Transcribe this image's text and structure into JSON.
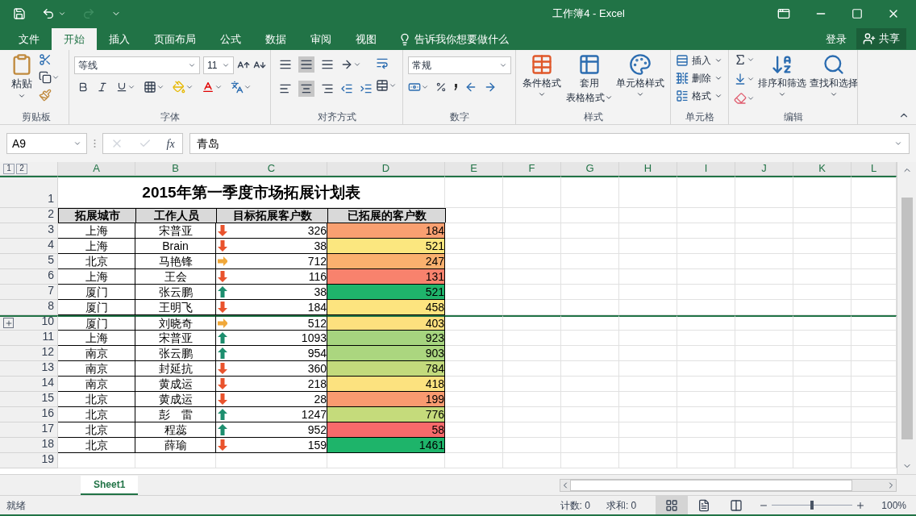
{
  "window": {
    "title": "工作簿4 - Excel"
  },
  "tabs": [
    {
      "label": "文件",
      "selected": false
    },
    {
      "label": "开始",
      "selected": true
    },
    {
      "label": "插入",
      "selected": false
    },
    {
      "label": "页面布局",
      "selected": false
    },
    {
      "label": "公式",
      "selected": false
    },
    {
      "label": "数据",
      "selected": false
    },
    {
      "label": "审阅",
      "selected": false
    },
    {
      "label": "视图",
      "selected": false
    }
  ],
  "tell_me": {
    "placeholder": "告诉我你想要做什么"
  },
  "sign_in": "登录",
  "share": "共享",
  "ribbon": {
    "clipboard": {
      "label": "剪贴板",
      "paste": "粘贴"
    },
    "font": {
      "label": "字体",
      "font": "等线",
      "size": "11"
    },
    "alignment": {
      "label": "对齐方式"
    },
    "number": {
      "label": "数字",
      "format": "常规"
    },
    "styles": {
      "label": "样式",
      "buttons": [
        "条件格式",
        "套用",
        "表格格式",
        "单元格样式"
      ]
    },
    "cells": {
      "label": "单元格",
      "items": [
        "插入",
        "删除",
        "格式"
      ]
    },
    "editing": {
      "label": "编辑",
      "buttons": [
        "排序和筛选",
        "查找和选择"
      ]
    }
  },
  "formula_bar": {
    "name_box": "A9",
    "fx": "fx",
    "value": "青岛"
  },
  "outline_levels": [
    "1",
    "2"
  ],
  "columns": [
    "A",
    "B",
    "C",
    "D",
    "E",
    "F",
    "G",
    "H",
    "I",
    "J",
    "K",
    "L"
  ],
  "sheet_title": {
    "row": "1",
    "text": "2015年第一季度市场拓展计划表"
  },
  "header_row": {
    "row": "2",
    "cells": [
      "拓展城市",
      "工作人员",
      "目标拓展客户数",
      "已拓展的客户数"
    ]
  },
  "rows": [
    {
      "row": "3",
      "city": "上海",
      "name": "宋普亚",
      "trend": {
        "kind": "down"
      },
      "target": "326",
      "done": "184",
      "color": "#f9a071",
      "after_hidden": false
    },
    {
      "row": "4",
      "city": "上海",
      "name": "Brain",
      "trend": {
        "kind": "down"
      },
      "target": "38",
      "done": "521",
      "color": "#fbe77f",
      "after_hidden": false
    },
    {
      "row": "5",
      "city": "北京",
      "name": "马艳锋",
      "trend": {
        "kind": "right"
      },
      "target": "712",
      "done": "247",
      "color": "#fab06e",
      "after_hidden": false
    },
    {
      "row": "6",
      "city": "上海",
      "name": "王会",
      "trend": {
        "kind": "down"
      },
      "target": "116",
      "done": "131",
      "color": "#f8826d",
      "after_hidden": false
    },
    {
      "row": "7",
      "city": "厦门",
      "name": "张云鹏",
      "trend": {
        "kind": "up"
      },
      "target": "38",
      "done": "521",
      "color": "#1fb46b",
      "after_hidden": false
    },
    {
      "row": "8",
      "city": "厦门",
      "name": "王明飞",
      "trend": {
        "kind": "down"
      },
      "target": "184",
      "done": "458",
      "color": "#fde47f",
      "after_hidden": false
    },
    {
      "row": "10",
      "city": "厦门",
      "name": "刘晓奇",
      "trend": {
        "kind": "right"
      },
      "target": "512",
      "done": "403",
      "color": "#fde07e",
      "after_hidden": true
    },
    {
      "row": "11",
      "city": "上海",
      "name": "宋普亚",
      "trend": {
        "kind": "up"
      },
      "target": "1093",
      "done": "923",
      "color": "#a6d47f",
      "after_hidden": false
    },
    {
      "row": "12",
      "city": "南京",
      "name": "张云鹏",
      "trend": {
        "kind": "up"
      },
      "target": "954",
      "done": "903",
      "color": "#abd67f",
      "after_hidden": false
    },
    {
      "row": "13",
      "city": "南京",
      "name": "封延抗",
      "trend": {
        "kind": "down"
      },
      "target": "360",
      "done": "784",
      "color": "#c3da7c",
      "after_hidden": false
    },
    {
      "row": "14",
      "city": "南京",
      "name": "黄成运",
      "trend": {
        "kind": "down"
      },
      "target": "218",
      "done": "418",
      "color": "#fce27f",
      "after_hidden": false
    },
    {
      "row": "15",
      "city": "北京",
      "name": "黄成运",
      "trend": {
        "kind": "down"
      },
      "target": "28",
      "done": "199",
      "color": "#f99a70",
      "after_hidden": false
    },
    {
      "row": "16",
      "city": "北京",
      "name": "彭　雷",
      "trend": {
        "kind": "up"
      },
      "target": "1247",
      "done": "776",
      "color": "#c5db7b",
      "after_hidden": false
    },
    {
      "row": "17",
      "city": "北京",
      "name": "程蕊",
      "trend": {
        "kind": "up"
      },
      "target": "952",
      "done": "58",
      "color": "#f8696b",
      "after_hidden": false
    },
    {
      "row": "18",
      "city": "北京",
      "name": "薛瑜",
      "trend": {
        "kind": "down"
      },
      "target": "159",
      "done": "1461",
      "color": "#1eb46a",
      "after_hidden": false
    }
  ],
  "empty_rows": [
    "19"
  ],
  "outline_group": {
    "collapsed": true
  },
  "sheet_tabs": [
    {
      "label": "Sheet1",
      "selected": true
    }
  ],
  "status_bar": {
    "status": "就绪",
    "count": "计数: 0",
    "sum": "求和: 0",
    "zoom": "100%",
    "zoom_slider": {
      "level": 0.5
    }
  }
}
